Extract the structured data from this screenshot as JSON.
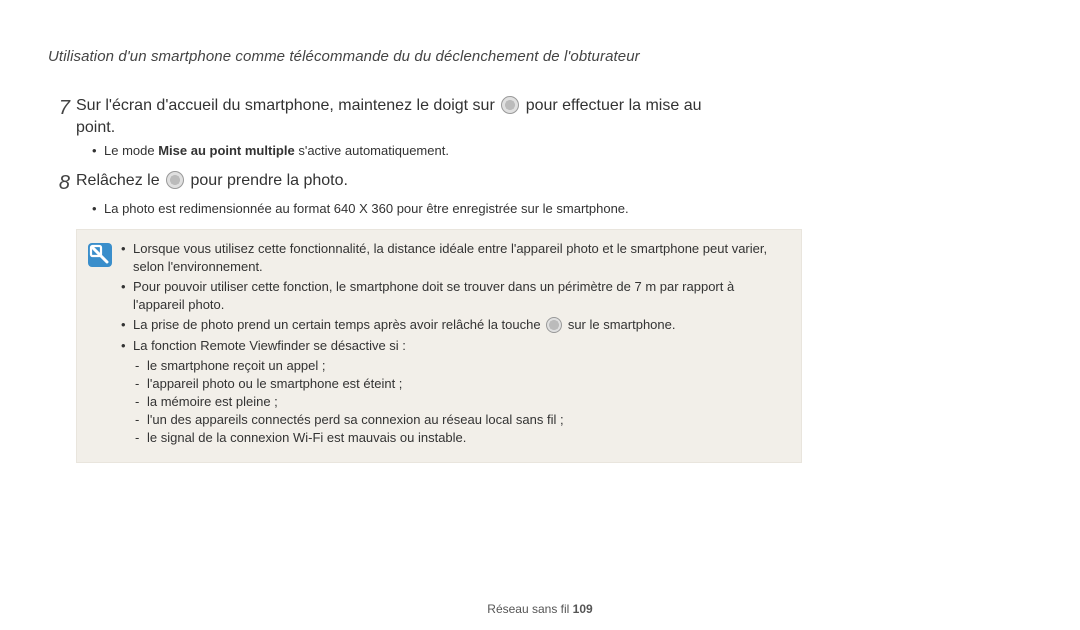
{
  "header": "Utilisation d'un smartphone comme télécommande du du déclenchement de l'obturateur",
  "step7": {
    "num": "7",
    "text_a": "Sur l'écran d'accueil du smartphone, maintenez le doigt sur ",
    "text_b": " pour effectuer la mise au point.",
    "bullet_pre": "Le mode ",
    "bullet_bold": "Mise au point multiple",
    "bullet_post": " s'active automatiquement."
  },
  "step8": {
    "num": "8",
    "text_a": "Relâchez le ",
    "text_b": " pour prendre la photo.",
    "bullet": "La photo est redimensionnée au format 640 X 360 pour être enregistrée sur le smartphone."
  },
  "note": {
    "b1": "Lorsque vous utilisez cette fonctionnalité, la distance idéale entre l'appareil photo et le smartphone peut varier, selon l'environnement.",
    "b2": "Pour pouvoir utiliser cette fonction, le smartphone doit se trouver dans un périmètre de 7 m par rapport à l'appareil photo.",
    "b3_a": "La prise de photo prend un certain temps après avoir relâché la touche ",
    "b3_b": " sur le smartphone.",
    "b4": "La fonction Remote Viewfinder se désactive si :",
    "s1": "le smartphone reçoit un appel ;",
    "s2": "l'appareil photo ou le smartphone est éteint ;",
    "s3": "la mémoire est pleine ;",
    "s4": "l'un des appareils connectés perd sa connexion au réseau local sans fil ;",
    "s5": "le signal de la connexion Wi-Fi est mauvais ou instable."
  },
  "footer": {
    "section": "Réseau sans fil  ",
    "page": "109"
  }
}
